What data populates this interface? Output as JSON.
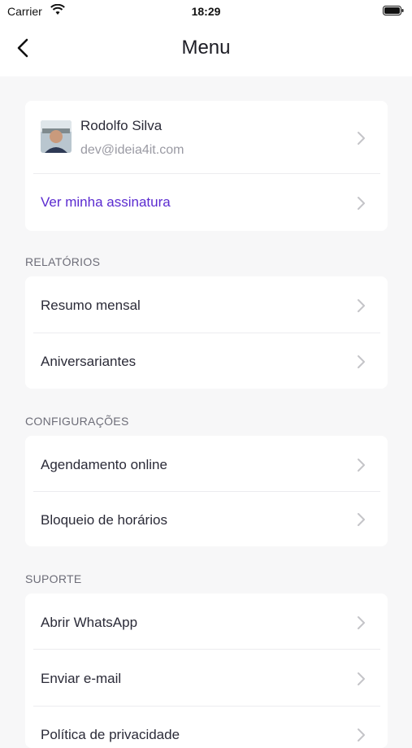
{
  "status_bar": {
    "carrier": "Carrier",
    "time": "18:29"
  },
  "nav": {
    "title": "Menu"
  },
  "profile": {
    "name": "Rodolfo Silva",
    "email": "dev@ideia4it.com",
    "subscription_link": "Ver minha assinatura"
  },
  "sections": {
    "reports": {
      "title": "RELATÓRIOS",
      "items": [
        "Resumo mensal",
        "Aniversariantes"
      ]
    },
    "settings": {
      "title": "CONFIGURAÇÕES",
      "items": [
        "Agendamento online",
        "Bloqueio de horários"
      ]
    },
    "support": {
      "title": "SUPORTE",
      "items": [
        "Abrir WhatsApp",
        "Enviar e-mail",
        "Política de privacidade"
      ]
    }
  },
  "colors": {
    "accent": "#5b2bd0",
    "background": "#f7f7f8"
  }
}
